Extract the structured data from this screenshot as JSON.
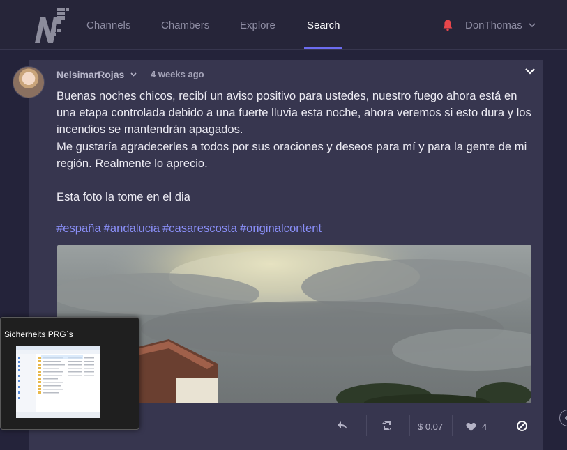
{
  "nav": {
    "items": [
      "Channels",
      "Chambers",
      "Explore",
      "Search"
    ],
    "active": "Search",
    "username": "DonThomas"
  },
  "post": {
    "author": "NelsimarRojas",
    "time": "4 weeks ago",
    "paragraphs": [
      "Buenas noches chicos, recibí un aviso positivo para ustedes, nuestro fuego ahora está en una etapa controlada debido a una fuerte lluvia esta noche, ahora veremos si esto dura y los incendios se mantendrán apagados.",
      "Me gustaría agradecerles a todos por sus oraciones y deseos para mí y para la gente de mi región. Realmente lo aprecio.",
      "",
      "Esta foto la tome en el dia"
    ],
    "hashtags": [
      "#españa",
      "#andalucia",
      "#casarescosta",
      "#originalcontent"
    ],
    "payout": "$ 0.07",
    "likes": "4"
  },
  "taskbar_preview": {
    "title": "Sicherheits PRG´s"
  },
  "colors": {
    "background": "#24233a",
    "card": "#37364f",
    "accent": "#6c6cf0",
    "hashtag": "#8a8ff8",
    "bell": "#e8464b"
  },
  "icons": {
    "logo": "nf-logo",
    "notifications": "bell-icon",
    "reply": "reply-arrow-icon",
    "resteem": "retweet-icon",
    "like": "heart-icon",
    "flag": "block-icon"
  }
}
